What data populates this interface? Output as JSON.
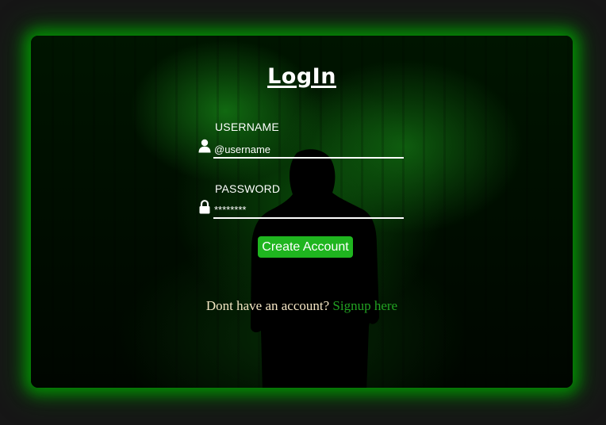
{
  "page": {
    "background_color": "#161616",
    "card_glow_color": "#00aa00"
  },
  "login": {
    "title": "LogIn",
    "username": {
      "label": "USERNAME",
      "placeholder": "@username",
      "icon": "user-icon"
    },
    "password": {
      "label": "PASSWORD",
      "placeholder": "********",
      "icon": "lock-icon"
    },
    "submit_label": "Create Account",
    "submit_color": "#1fb51f",
    "signup_prompt": "Dont have an account?",
    "signup_link": "Signup here",
    "signup_link_color": "#22a322"
  }
}
